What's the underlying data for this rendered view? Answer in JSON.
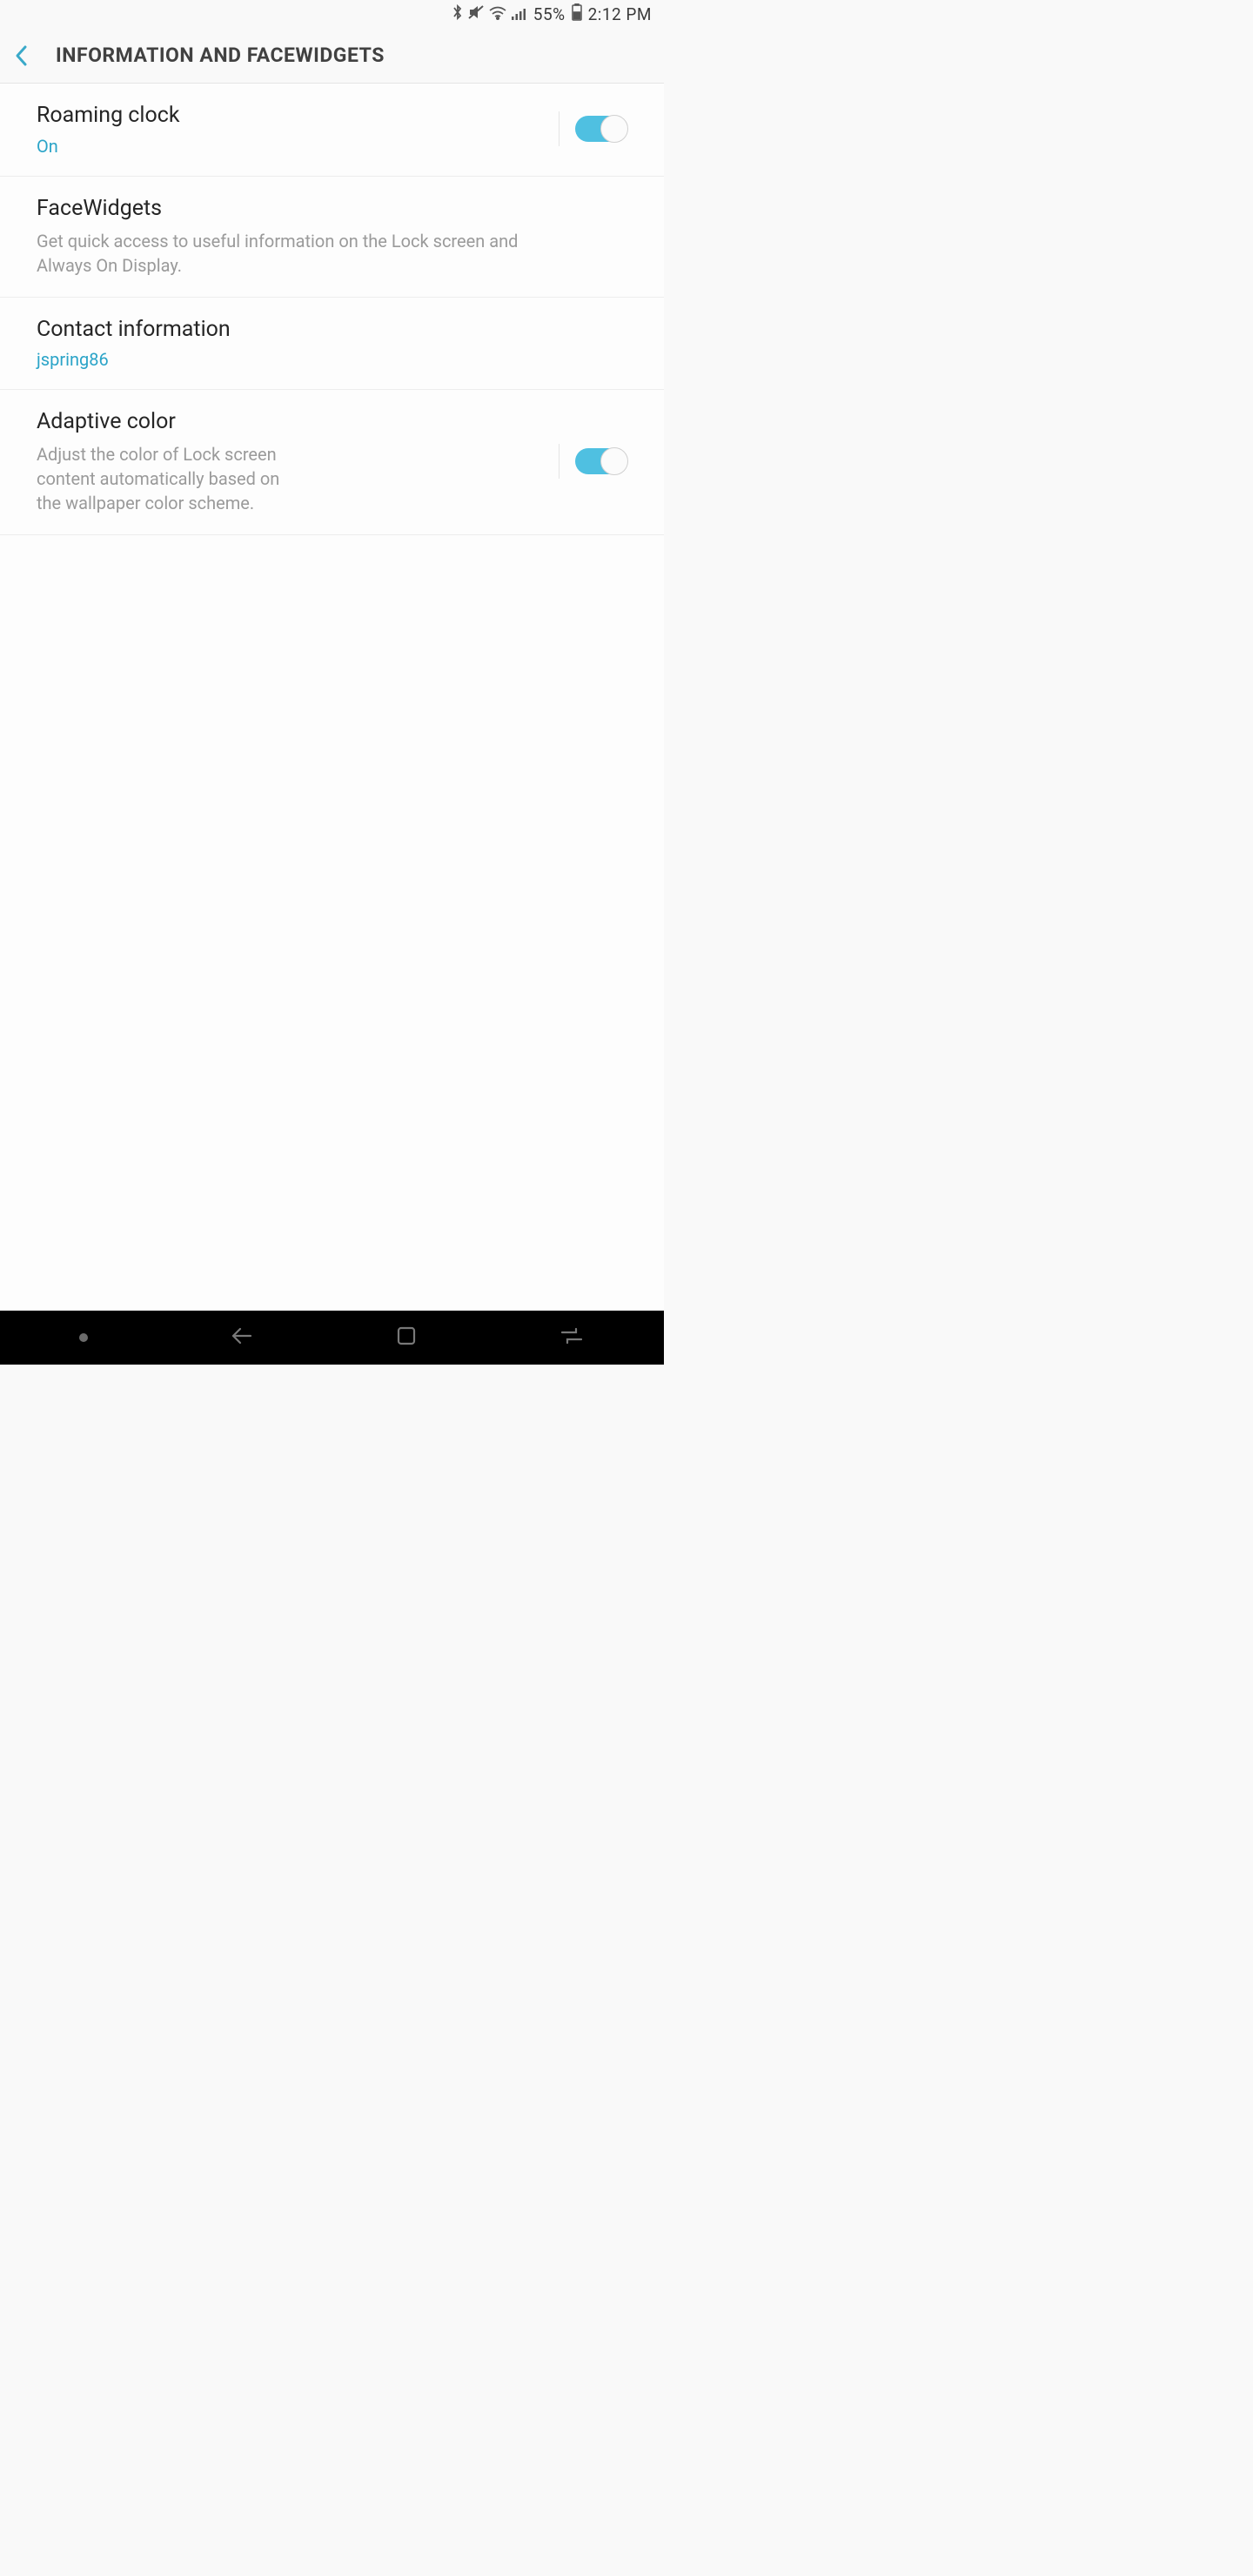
{
  "status": {
    "battery": "55%",
    "time": "2:12 PM"
  },
  "header": {
    "title": "INFORMATION AND FACEWIDGETS"
  },
  "items": {
    "roaming": {
      "title": "Roaming clock",
      "value": "On",
      "toggle": true
    },
    "facewidgets": {
      "title": "FaceWidgets",
      "desc": "Get quick access to useful information on the Lock screen and Always On Display."
    },
    "contact": {
      "title": "Contact information",
      "value": "jspring86"
    },
    "adaptive": {
      "title": "Adaptive color",
      "desc": "Adjust the color of Lock screen content automatically based on the wallpaper color scheme.",
      "toggle": true
    }
  }
}
